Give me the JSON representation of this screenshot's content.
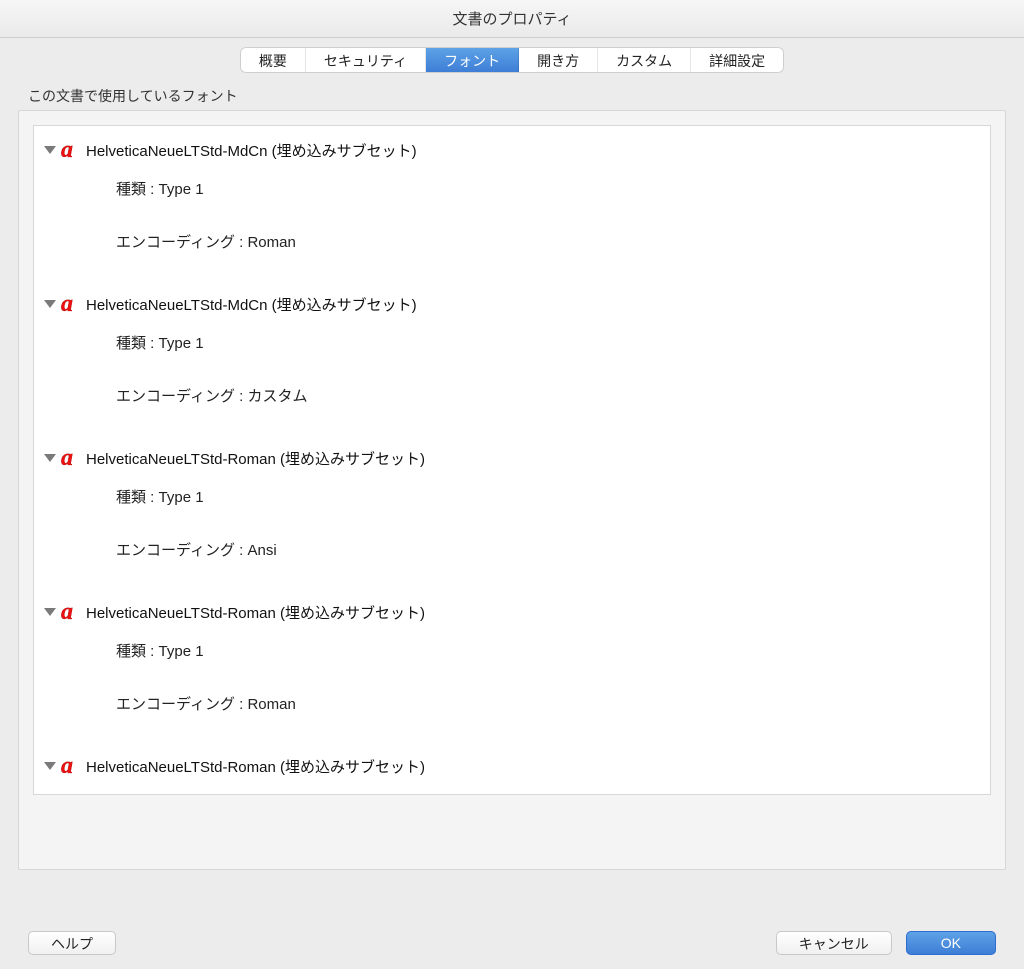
{
  "window": {
    "title": "文書のプロパティ"
  },
  "tabs": [
    {
      "label": "概要",
      "active": false
    },
    {
      "label": "セキュリティ",
      "active": false
    },
    {
      "label": "フォント",
      "active": true
    },
    {
      "label": "開き方",
      "active": false
    },
    {
      "label": "カスタム",
      "active": false
    },
    {
      "label": "詳細設定",
      "active": false
    }
  ],
  "section_label": "この文書で使用しているフォント",
  "labels": {
    "type": "種類 : ",
    "encoding": "エンコーディング : "
  },
  "fonts": [
    {
      "name": "HelveticaNeueLTStd-MdCn (埋め込みサブセット)",
      "type": "Type 1",
      "encoding": "Roman"
    },
    {
      "name": "HelveticaNeueLTStd-MdCn (埋め込みサブセット)",
      "type": "Type 1",
      "encoding": "カスタム"
    },
    {
      "name": "HelveticaNeueLTStd-Roman (埋め込みサブセット)",
      "type": "Type 1",
      "encoding": "Ansi"
    },
    {
      "name": "HelveticaNeueLTStd-Roman (埋め込みサブセット)",
      "type": "Type 1",
      "encoding": "Roman"
    },
    {
      "name": "HelveticaNeueLTStd-Roman (埋め込みサブセット)",
      "type": "",
      "encoding": ""
    }
  ],
  "buttons": {
    "help": "ヘルプ",
    "cancel": "キャンセル",
    "ok": "OK"
  }
}
